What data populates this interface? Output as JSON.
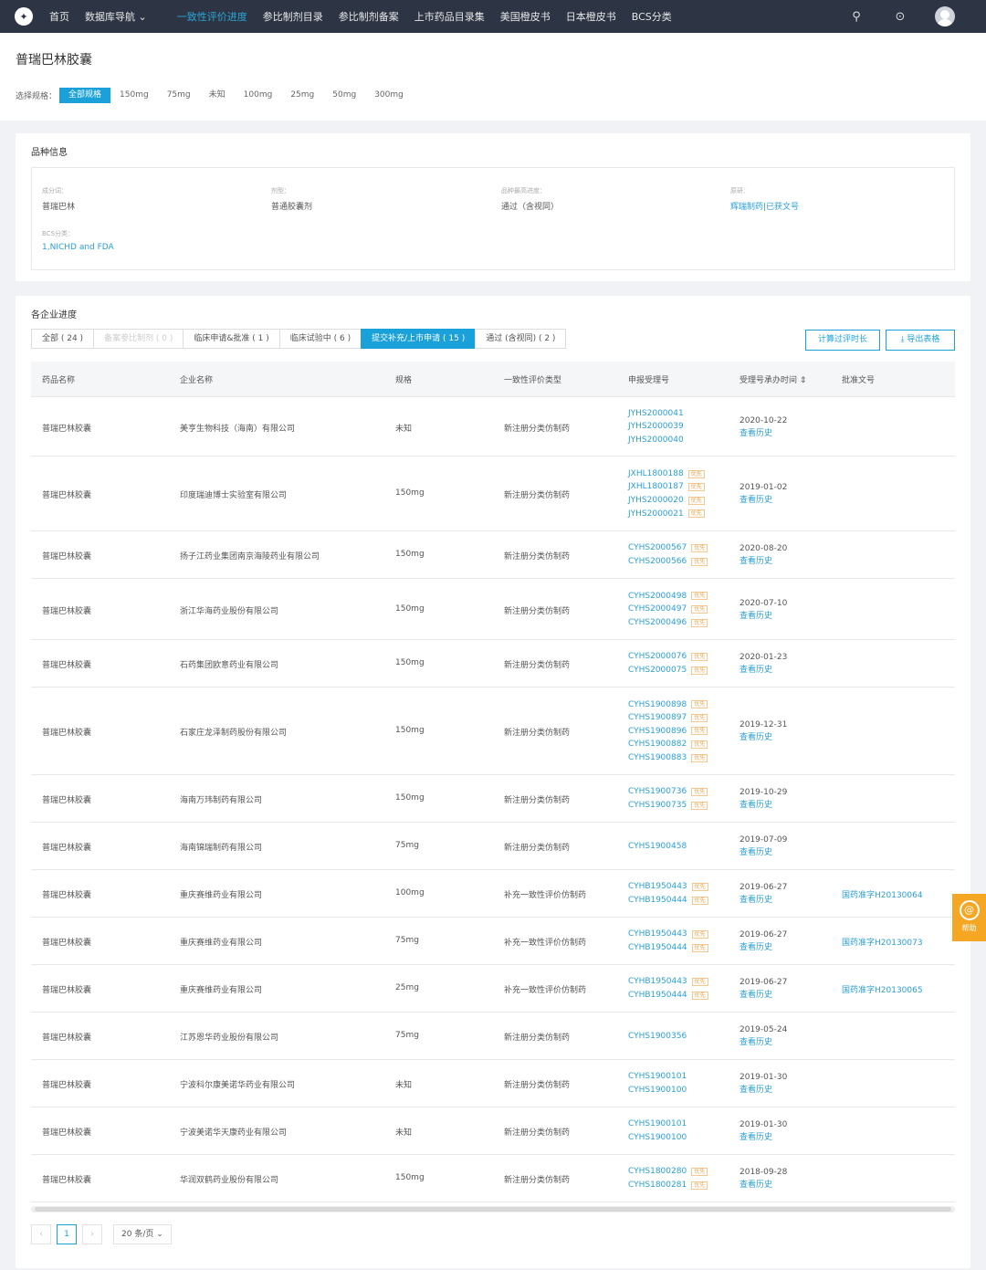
{
  "nav": {
    "logo": "✦",
    "items": [
      "首页",
      "数据库导航 ⌄",
      "一致性评价进度",
      "参比制剂目录",
      "参比制剂备案",
      "上市药品目录集",
      "美国橙皮书",
      "日本橙皮书",
      "BCS分类"
    ],
    "active_index": 2,
    "search_icon": "⚲",
    "help_icon": "⊙"
  },
  "page": {
    "title": "普瑞巴林胶囊",
    "spec_label": "选择规格：",
    "specs": [
      "全部规格",
      "150mg",
      "75mg",
      "未知",
      "100mg",
      "25mg",
      "50mg",
      "300mg"
    ]
  },
  "info": {
    "title": "品种信息",
    "ingredient_key": "成分词：",
    "ingredient_val": "普瑞巴林",
    "dosage_key": "剂型：",
    "dosage_val": "普通胶囊剂",
    "progress_key": "品种最高进度：",
    "progress_val": "通过（含视同）",
    "reference_key": "原研：",
    "reference_val": "辉瑞制药|已获文号",
    "bcs_key": "BCS分类：",
    "bcs_val": "1,NICHD and FDA"
  },
  "progress": {
    "title": "各企业进度",
    "tabs": [
      "全部 ( 24 )",
      "备案参比制剂 ( 0 )",
      "临床申请&批准 ( 1 )",
      "临床试验中 ( 6 )",
      "提交补充/上市申请 ( 15 )",
      "通过 (含视同) ( 2 )"
    ],
    "calc_btn": "计算过评时长",
    "export_btn": "⤓ 导出表格",
    "headers": [
      "药品名称",
      "企业名称",
      "规格",
      "一致性评价类型",
      "申报受理号",
      "受理号承办时间 ⇕",
      "批准文号"
    ],
    "badge_text": "优先",
    "history_text": "查看历史",
    "rows": [
      {
        "drug": "普瑞巴林胶囊",
        "company": "美亨生物科技（海南）有限公司",
        "spec": "未知",
        "type": "新注册分类仿制药",
        "codes": [
          "JYHS2000041",
          "JYHS2000039",
          "JYHS2000040"
        ],
        "badges": [
          false,
          false,
          false
        ],
        "date": "2020-10-22",
        "approval": ""
      },
      {
        "drug": "普瑞巴林胶囊",
        "company": "印度瑞迪博士实验室有限公司",
        "spec": "150mg",
        "type": "新注册分类仿制药",
        "codes": [
          "JXHL1800188",
          "JXHL1800187",
          "JYHS2000020",
          "JYHS2000021"
        ],
        "badges": [
          true,
          true,
          true,
          true
        ],
        "date": "2019-01-02",
        "approval": ""
      },
      {
        "drug": "普瑞巴林胶囊",
        "company": "扬子江药业集团南京海陵药业有限公司",
        "spec": "150mg",
        "type": "新注册分类仿制药",
        "codes": [
          "CYHS2000567",
          "CYHS2000566"
        ],
        "badges": [
          true,
          true
        ],
        "date": "2020-08-20",
        "approval": ""
      },
      {
        "drug": "普瑞巴林胶囊",
        "company": "浙江华海药业股份有限公司",
        "spec": "150mg",
        "type": "新注册分类仿制药",
        "codes": [
          "CYHS2000498",
          "CYHS2000497",
          "CYHS2000496"
        ],
        "badges": [
          true,
          true,
          true
        ],
        "date": "2020-07-10",
        "approval": ""
      },
      {
        "drug": "普瑞巴林胶囊",
        "company": "石药集团欧意药业有限公司",
        "spec": "150mg",
        "type": "新注册分类仿制药",
        "codes": [
          "CYHS2000076",
          "CYHS2000075"
        ],
        "badges": [
          true,
          true
        ],
        "date": "2020-01-23",
        "approval": ""
      },
      {
        "drug": "普瑞巴林胶囊",
        "company": "石家庄龙泽制药股份有限公司",
        "spec": "150mg",
        "type": "新注册分类仿制药",
        "codes": [
          "CYHS1900898",
          "CYHS1900897",
          "CYHS1900896",
          "CYHS1900882",
          "CYHS1900883"
        ],
        "badges": [
          true,
          true,
          true,
          true,
          true
        ],
        "date": "2019-12-31",
        "approval": ""
      },
      {
        "drug": "普瑞巴林胶囊",
        "company": "海南万玮制药有限公司",
        "spec": "150mg",
        "type": "新注册分类仿制药",
        "codes": [
          "CYHS1900736",
          "CYHS1900735"
        ],
        "badges": [
          true,
          true
        ],
        "date": "2019-10-29",
        "approval": ""
      },
      {
        "drug": "普瑞巴林胶囊",
        "company": "海南锦瑞制药有限公司",
        "spec": "75mg",
        "type": "新注册分类仿制药",
        "codes": [
          "CYHS1900458"
        ],
        "badges": [
          false
        ],
        "date": "2019-07-09",
        "approval": ""
      },
      {
        "drug": "普瑞巴林胶囊",
        "company": "重庆赛维药业有限公司",
        "spec": "100mg",
        "type": "补充一致性评价仿制药",
        "codes": [
          "CYHB1950443",
          "CYHB1950444"
        ],
        "badges": [
          true,
          true
        ],
        "date": "2019-06-27",
        "approval": "国药准字H20130064"
      },
      {
        "drug": "普瑞巴林胶囊",
        "company": "重庆赛维药业有限公司",
        "spec": "75mg",
        "type": "补充一致性评价仿制药",
        "codes": [
          "CYHB1950443",
          "CYHB1950444"
        ],
        "badges": [
          true,
          true
        ],
        "date": "2019-06-27",
        "approval": "国药准字H20130073"
      },
      {
        "drug": "普瑞巴林胶囊",
        "company": "重庆赛维药业有限公司",
        "spec": "25mg",
        "type": "补充一致性评价仿制药",
        "codes": [
          "CYHB1950443",
          "CYHB1950444"
        ],
        "badges": [
          true,
          true
        ],
        "date": "2019-06-27",
        "approval": "国药准字H20130065"
      },
      {
        "drug": "普瑞巴林胶囊",
        "company": "江苏恩华药业股份有限公司",
        "spec": "75mg",
        "type": "新注册分类仿制药",
        "codes": [
          "CYHS1900356"
        ],
        "badges": [
          false
        ],
        "date": "2019-05-24",
        "approval": ""
      },
      {
        "drug": "普瑞巴林胶囊",
        "company": "宁波科尔康美诺华药业有限公司",
        "spec": "未知",
        "type": "新注册分类仿制药",
        "codes": [
          "CYHS1900101",
          "CYHS1900100"
        ],
        "badges": [
          false,
          false
        ],
        "date": "2019-01-30",
        "approval": ""
      },
      {
        "drug": "普瑞巴林胶囊",
        "company": "宁波美诺华天康药业有限公司",
        "spec": "未知",
        "type": "新注册分类仿制药",
        "codes": [
          "CYHS1900101",
          "CYHS1900100"
        ],
        "badges": [
          false,
          false
        ],
        "date": "2019-01-30",
        "approval": ""
      },
      {
        "drug": "普瑞巴林胶囊",
        "company": "华润双鹤药业股份有限公司",
        "spec": "150mg",
        "type": "新注册分类仿制药",
        "codes": [
          "CYHS1800280",
          "CYHS1800281"
        ],
        "badges": [
          true,
          true
        ],
        "date": "2018-09-28",
        "approval": ""
      }
    ]
  },
  "pager": {
    "prev": "‹",
    "page": "1",
    "next": "›",
    "size": "20 条/页 ⌄"
  },
  "help": {
    "icon": "@",
    "label": "帮助"
  }
}
